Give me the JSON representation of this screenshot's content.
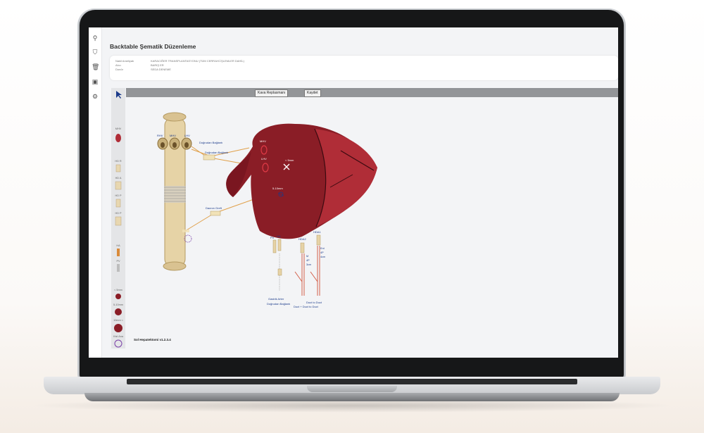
{
  "app": {
    "title": "Backtable Şematik Düzenleme",
    "info": [
      {
        "label": "Nakil Ameliyatı",
        "value": "KARACIĞER TRANSPLANTASYONU (TÜM CERRAHİ İŞLEMLER DAHİL)"
      },
      {
        "label": "Alıcı",
        "value": "BARIŞ ER"
      },
      {
        "label": "Donör",
        "value": "SEDA DENEME"
      }
    ],
    "toolbar": {
      "replace_label": "Kava Replasmanı",
      "save_label": "Kaydet"
    },
    "sidebar_icons": [
      "pin-icon",
      "shield-icon",
      "trash-icon",
      "bus-icon",
      "gear-icon"
    ],
    "toolbox": {
      "items": [
        "MHV",
        "HD R",
        "HD A",
        "HD P",
        "HD P",
        "HA",
        "PV",
        "< 5mm",
        "5-10mm",
        "10mm <",
        "Kist Ana"
      ]
    },
    "diagram_labels": {
      "rhv": "RHV",
      "mhv_top": "MHV",
      "lhv": "LHV",
      "dogrudan_baglanti": "Doğrudan Bağlantı",
      "dogrudan_baglanti_2": "Doğrudan Bağlantı",
      "dacron_greft": "Dacron Greft",
      "mhv": "MHV",
      "lhv_on": "LHV",
      "lt5": "< 5mm",
      "range": "5-10mm",
      "pv": "PV",
      "ha": "HA",
      "hda2": "HDA2",
      "hda1": "HDA1",
      "m1": "M",
      "m2": "4P",
      "m3": "3cm",
      "e1": "Ent",
      "e2": "4P",
      "e3": "4cm",
      "gastrik": "Gastrik Arter",
      "gastrik2": "Doğrudan Bağlantı",
      "duct1": "Duct to Duct",
      "duct2": "Duct + Duct to Duct"
    },
    "footer": {
      "version": "Sol Hepatektomi v1.2.3.4"
    },
    "colors": {
      "liver": "#8a1d26",
      "liver_light": "#b02d37",
      "vessel": "#e8d7b0",
      "graft": "#d9c9a0",
      "accent": "#1a3a8a"
    }
  }
}
